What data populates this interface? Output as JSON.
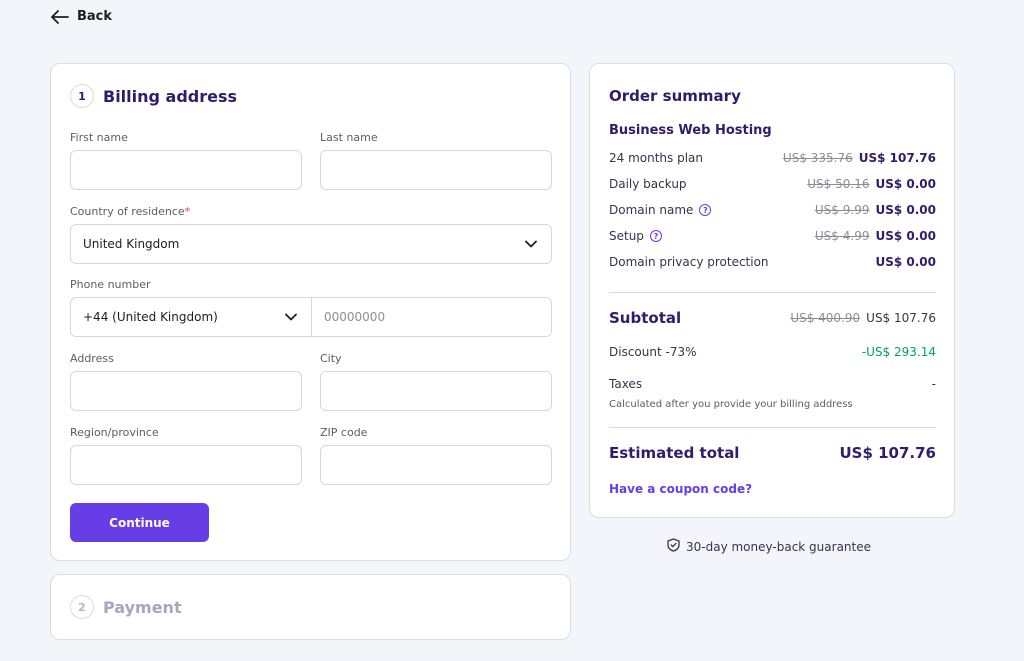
{
  "nav": {
    "back_label": "Back"
  },
  "billing": {
    "step_number": "1",
    "title": "Billing address",
    "first_name_label": "First name",
    "last_name_label": "Last name",
    "country_label": "Country of residence",
    "country_required_mark": "*",
    "country_value": "United Kingdom",
    "phone_label": "Phone number",
    "phone_code_value": "+44 (United Kingdom)",
    "phone_placeholder": "00000000",
    "address_label": "Address",
    "city_label": "City",
    "region_label": "Region/province",
    "zip_label": "ZIP code",
    "continue_label": "Continue"
  },
  "payment": {
    "step_number": "2",
    "title": "Payment"
  },
  "summary": {
    "title": "Order summary",
    "plan_name": "Business Web Hosting",
    "items": [
      {
        "label": "24 months plan",
        "old_price": "US$ 335.76",
        "price": "US$ 107.76"
      },
      {
        "label": "Daily backup",
        "old_price": "US$ 50.16",
        "price": "US$ 0.00"
      },
      {
        "label": "Domain name",
        "old_price": "US$ 9.99",
        "price": "US$ 0.00"
      },
      {
        "label": "Setup",
        "old_price": "US$ 4.99",
        "price": "US$ 0.00"
      },
      {
        "label": "Domain privacy protection",
        "old_price": "",
        "price": "US$ 0.00"
      }
    ],
    "subtotal_label": "Subtotal",
    "subtotal_old": "US$ 400.90",
    "subtotal_value": "US$ 107.76",
    "discount_label": "Discount -73%",
    "discount_value": "-US$ 293.14",
    "taxes_label": "Taxes",
    "taxes_value": "-",
    "taxes_note": "Calculated after you provide your billing address",
    "estimated_label": "Estimated total",
    "estimated_value": "US$ 107.76",
    "coupon_label": "Have a coupon code?"
  },
  "guarantee_text": "30-day money-back guarantee",
  "colors": {
    "accent": "#673de6",
    "heading": "#2f1c6a",
    "discount": "#00a65a",
    "background": "#f4f4fb"
  }
}
